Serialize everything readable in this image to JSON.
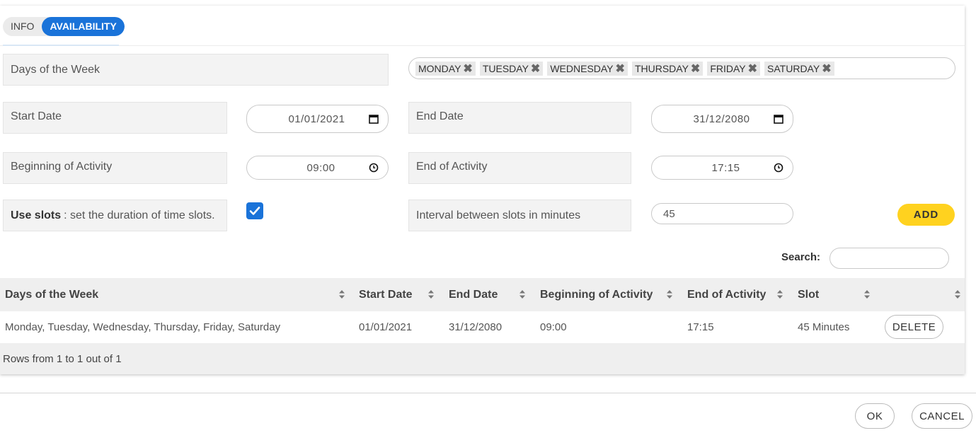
{
  "tabs": [
    {
      "label": "INFO",
      "active": false
    },
    {
      "label": "AVAILABILITY",
      "active": true
    }
  ],
  "form": {
    "days_label": "Days of the Week",
    "days_tags": [
      "MONDAY",
      "TUESDAY",
      "WEDNESDAY",
      "THURSDAY",
      "FRIDAY",
      "SATURDAY"
    ],
    "start_date_label": "Start Date",
    "start_date_value": "01/01/2021",
    "end_date_label": "End Date",
    "end_date_value": "31/12/2080",
    "begin_label": "Beginning of Activity",
    "begin_value": "09:00",
    "end_label": "End of Activity",
    "end_value": "17:15",
    "use_slots_bold": "Use slots",
    "use_slots_rest": ": set the duration of time slots.",
    "use_slots_checked": true,
    "interval_label": "Interval between slots in minutes",
    "interval_value": "45",
    "add_label": "ADD"
  },
  "search": {
    "label": "Search:",
    "value": ""
  },
  "table": {
    "headers": [
      "Days of the Week",
      "Start Date",
      "End Date",
      "Beginning of Activity",
      "End of Activity",
      "Slot",
      ""
    ],
    "rows": [
      {
        "days": "Monday, Tuesday, Wednesday, Thursday, Friday, Saturday",
        "start": "01/01/2021",
        "end": "31/12/2080",
        "begin": "09:00",
        "end_activity": "17:15",
        "slot": "45 Minutes",
        "action": "DELETE"
      }
    ],
    "footer": "Rows from 1 to 1 out of 1"
  },
  "footer_buttons": {
    "ok": "OK",
    "cancel": "CANCEL"
  },
  "colors": {
    "accent": "#1a73d9",
    "add_button": "#ffd21f"
  }
}
